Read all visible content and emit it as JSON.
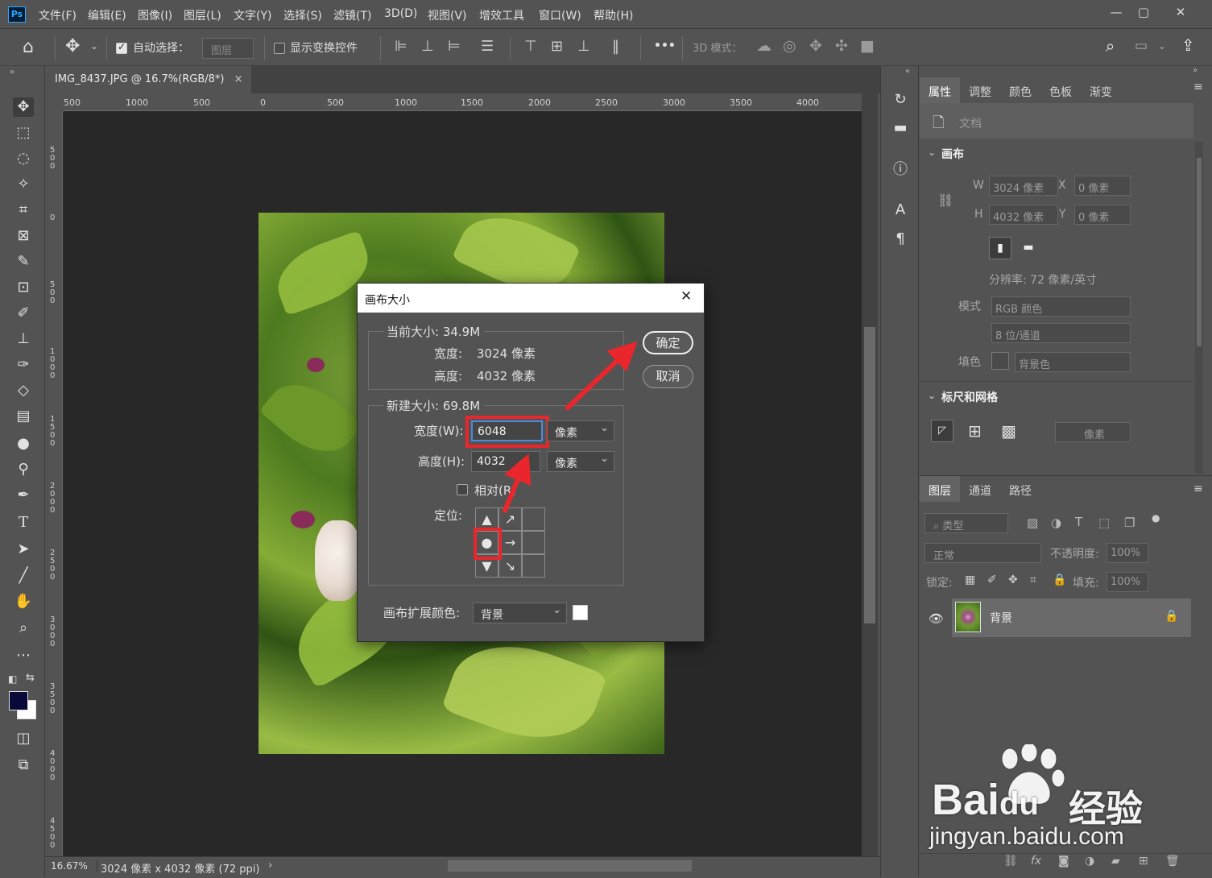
{
  "app": {
    "logo": "Ps",
    "menu": [
      "文件(F)",
      "编辑(E)",
      "图像(I)",
      "图层(L)",
      "文字(Y)",
      "选择(S)",
      "滤镜(T)",
      "3D(D)",
      "视图(V)",
      "增效工具",
      "窗口(W)",
      "帮助(H)"
    ],
    "window_controls": {
      "minimize": "—",
      "restore": "▢",
      "close": "✕"
    }
  },
  "options": {
    "auto_select_label": "自动选择：",
    "auto_select_target": "图层",
    "show_transform_label": "显示变换控件",
    "more": "•••",
    "mode_3d_label": "3D 模式："
  },
  "document": {
    "tab_title": "IMG_8437.JPG @ 16.7%(RGB/8*)",
    "close": "×",
    "zoom": "16.67%",
    "status": "3024 像素 x 4032 像素 (72 ppi)",
    "status_arrow": "›"
  },
  "ruler": {
    "top_ticks": [
      "500",
      "1000",
      "500",
      "0",
      "500",
      "1000",
      "1500",
      "2000",
      "2500",
      "3000",
      "3500",
      "4000"
    ],
    "left_ticks": [
      "500",
      "0",
      "500",
      "1000",
      "1500",
      "2000",
      "2500",
      "3000",
      "3500",
      "4000",
      "4500"
    ]
  },
  "dialog": {
    "title": "画布大小",
    "close": "✕",
    "current_size_label": "当前大小: 34.9M",
    "current_width_label": "宽度:",
    "current_width_value": "3024 像素",
    "current_height_label": "高度:",
    "current_height_value": "4032 像素",
    "new_size_label": "新建大小: 69.8M",
    "width_label": "宽度(W):",
    "width_value": "6048",
    "width_unit": "像素",
    "height_label": "高度(H):",
    "height_value": "4032",
    "height_unit": "像素",
    "relative_label": "相对(R)",
    "anchor_label": "定位:",
    "extension_color_label": "画布扩展颜色:",
    "extension_color_value": "背景",
    "ok_button": "确定",
    "cancel_button": "取消",
    "extension_swatch_color": "#ffffff"
  },
  "properties": {
    "tabs": [
      "属性",
      "调整",
      "颜色",
      "色板",
      "渐变"
    ],
    "doc_label": "文档",
    "canvas_section": "画布",
    "w_label": "W",
    "w_value": "3024 像素",
    "h_label": "H",
    "h_value": "4032 像素",
    "x_label": "X",
    "x_value": "0 像素",
    "y_label": "Y",
    "y_value": "0 像素",
    "resolution": "分辨率: 72 像素/英寸",
    "mode_label": "模式",
    "mode_value": "RGB 颜色",
    "depth_value": "8 位/通道",
    "fill_label": "填色",
    "fill_value": "背景色",
    "rulers_section": "标尺和网格",
    "ruler_unit": "像素"
  },
  "layers": {
    "tabs": [
      "图层",
      "通道",
      "路径"
    ],
    "filter_label": "类型",
    "blend_mode": "正常",
    "opacity_label": "不透明度:",
    "opacity_value": "100%",
    "lock_label": "锁定:",
    "fill_label": "填充:",
    "fill_value": "100%",
    "layer_name": "背景"
  },
  "watermark": {
    "brand_a": "Bai",
    "brand_b": "du",
    "brand_cn": "经验",
    "url": "jingyan.baidu.com"
  },
  "colors": {
    "foreground": "#0a0a3a",
    "background": "#ffffff",
    "highlight": "#e8262c"
  }
}
